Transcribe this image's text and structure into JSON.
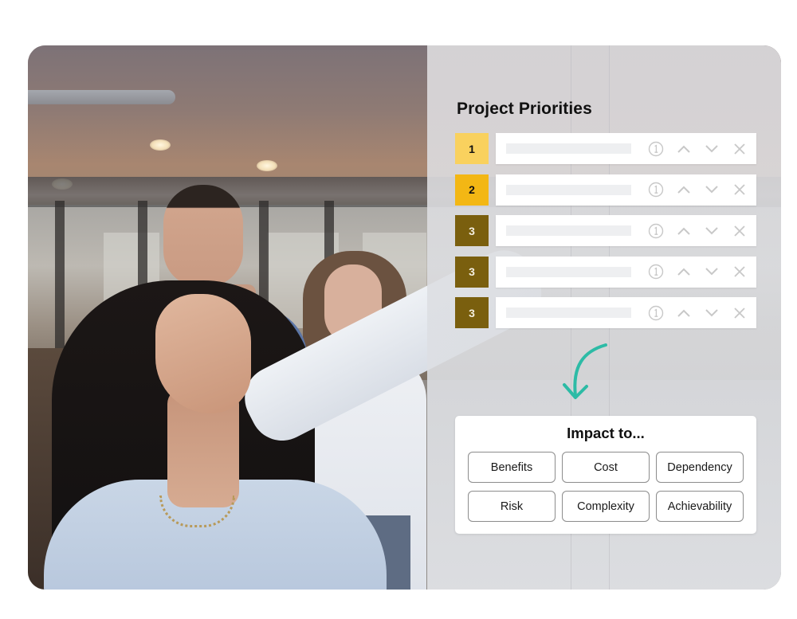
{
  "panel": {
    "title": "Project Priorities"
  },
  "colors": {
    "rank_1": "#F9D15E",
    "rank_2": "#F3B714",
    "rank_3": "#7A5F0E",
    "rank_text_dark": "#111111",
    "rank_text_light": "#F4EFE0",
    "icon_gray": "#C8C8C8",
    "arrow_teal": "#2DBBA6",
    "placeholder_bar": "#EEEFF1"
  },
  "priorities": [
    {
      "rank": "1",
      "level": "rank_1",
      "text_color": "rank_text_dark",
      "icons": [
        "info-icon",
        "move-up-icon",
        "move-down-icon",
        "remove-icon"
      ]
    },
    {
      "rank": "2",
      "level": "rank_2",
      "text_color": "rank_text_dark",
      "icons": [
        "info-icon",
        "move-up-icon",
        "move-down-icon",
        "remove-icon"
      ]
    },
    {
      "rank": "3",
      "level": "rank_3",
      "text_color": "rank_text_light",
      "icons": [
        "info-icon",
        "move-up-icon",
        "move-down-icon",
        "remove-icon"
      ]
    },
    {
      "rank": "3",
      "level": "rank_3",
      "text_color": "rank_text_light",
      "icons": [
        "info-icon",
        "move-up-icon",
        "move-down-icon",
        "remove-icon"
      ]
    },
    {
      "rank": "3",
      "level": "rank_3",
      "text_color": "rank_text_light",
      "icons": [
        "info-icon",
        "move-up-icon",
        "move-down-icon",
        "remove-icon"
      ]
    }
  ],
  "impact": {
    "title": "Impact to...",
    "options": [
      "Benefits",
      "Cost",
      "Dependency",
      "Risk",
      "Complexity",
      "Achievability"
    ]
  },
  "photo": {
    "description": "Three colleagues in an office looking at a wall; woman in front reaching toward it"
  }
}
